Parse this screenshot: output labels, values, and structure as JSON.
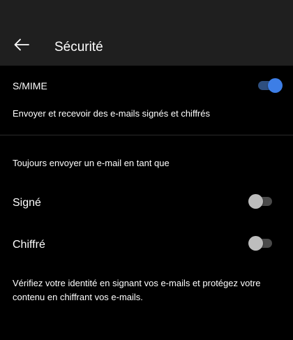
{
  "header": {
    "title": "Sécurité",
    "back_icon": "arrow-left-icon"
  },
  "smime": {
    "label": "S/MIME",
    "description": "Envoyer et recevoir des e-mails signés et chiffrés",
    "enabled": true
  },
  "always_send": {
    "title": "Toujours envoyer un e-mail en tant que",
    "signed": {
      "label": "Signé",
      "enabled": false
    },
    "encrypted": {
      "label": "Chiffré",
      "enabled": false
    }
  },
  "footer": {
    "text": "Vérifiez votre identité en signant vos e-mails et protégez votre contenu en chiffrant vos e-mails."
  },
  "colors": {
    "background": "#000000",
    "app_bar": "#1f1f1f",
    "toggle_on_thumb": "#3d7ee6",
    "toggle_on_track": "#2e4f7f",
    "toggle_off_thumb": "#bdbdbd",
    "toggle_off_track": "#4a4a4a",
    "divider": "#2a2a2a"
  }
}
